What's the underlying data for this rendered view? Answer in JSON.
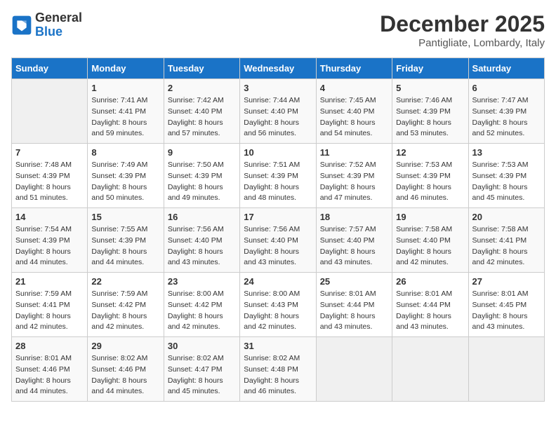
{
  "header": {
    "logo_line1": "General",
    "logo_line2": "Blue",
    "month": "December 2025",
    "location": "Pantigliate, Lombardy, Italy"
  },
  "days_of_week": [
    "Sunday",
    "Monday",
    "Tuesday",
    "Wednesday",
    "Thursday",
    "Friday",
    "Saturday"
  ],
  "weeks": [
    [
      {
        "day": "",
        "info": ""
      },
      {
        "day": "1",
        "info": "Sunrise: 7:41 AM\nSunset: 4:41 PM\nDaylight: 8 hours\nand 59 minutes."
      },
      {
        "day": "2",
        "info": "Sunrise: 7:42 AM\nSunset: 4:40 PM\nDaylight: 8 hours\nand 57 minutes."
      },
      {
        "day": "3",
        "info": "Sunrise: 7:44 AM\nSunset: 4:40 PM\nDaylight: 8 hours\nand 56 minutes."
      },
      {
        "day": "4",
        "info": "Sunrise: 7:45 AM\nSunset: 4:40 PM\nDaylight: 8 hours\nand 54 minutes."
      },
      {
        "day": "5",
        "info": "Sunrise: 7:46 AM\nSunset: 4:39 PM\nDaylight: 8 hours\nand 53 minutes."
      },
      {
        "day": "6",
        "info": "Sunrise: 7:47 AM\nSunset: 4:39 PM\nDaylight: 8 hours\nand 52 minutes."
      }
    ],
    [
      {
        "day": "7",
        "info": "Sunrise: 7:48 AM\nSunset: 4:39 PM\nDaylight: 8 hours\nand 51 minutes."
      },
      {
        "day": "8",
        "info": "Sunrise: 7:49 AM\nSunset: 4:39 PM\nDaylight: 8 hours\nand 50 minutes."
      },
      {
        "day": "9",
        "info": "Sunrise: 7:50 AM\nSunset: 4:39 PM\nDaylight: 8 hours\nand 49 minutes."
      },
      {
        "day": "10",
        "info": "Sunrise: 7:51 AM\nSunset: 4:39 PM\nDaylight: 8 hours\nand 48 minutes."
      },
      {
        "day": "11",
        "info": "Sunrise: 7:52 AM\nSunset: 4:39 PM\nDaylight: 8 hours\nand 47 minutes."
      },
      {
        "day": "12",
        "info": "Sunrise: 7:53 AM\nSunset: 4:39 PM\nDaylight: 8 hours\nand 46 minutes."
      },
      {
        "day": "13",
        "info": "Sunrise: 7:53 AM\nSunset: 4:39 PM\nDaylight: 8 hours\nand 45 minutes."
      }
    ],
    [
      {
        "day": "14",
        "info": "Sunrise: 7:54 AM\nSunset: 4:39 PM\nDaylight: 8 hours\nand 44 minutes."
      },
      {
        "day": "15",
        "info": "Sunrise: 7:55 AM\nSunset: 4:39 PM\nDaylight: 8 hours\nand 44 minutes."
      },
      {
        "day": "16",
        "info": "Sunrise: 7:56 AM\nSunset: 4:40 PM\nDaylight: 8 hours\nand 43 minutes."
      },
      {
        "day": "17",
        "info": "Sunrise: 7:56 AM\nSunset: 4:40 PM\nDaylight: 8 hours\nand 43 minutes."
      },
      {
        "day": "18",
        "info": "Sunrise: 7:57 AM\nSunset: 4:40 PM\nDaylight: 8 hours\nand 43 minutes."
      },
      {
        "day": "19",
        "info": "Sunrise: 7:58 AM\nSunset: 4:40 PM\nDaylight: 8 hours\nand 42 minutes."
      },
      {
        "day": "20",
        "info": "Sunrise: 7:58 AM\nSunset: 4:41 PM\nDaylight: 8 hours\nand 42 minutes."
      }
    ],
    [
      {
        "day": "21",
        "info": "Sunrise: 7:59 AM\nSunset: 4:41 PM\nDaylight: 8 hours\nand 42 minutes."
      },
      {
        "day": "22",
        "info": "Sunrise: 7:59 AM\nSunset: 4:42 PM\nDaylight: 8 hours\nand 42 minutes."
      },
      {
        "day": "23",
        "info": "Sunrise: 8:00 AM\nSunset: 4:42 PM\nDaylight: 8 hours\nand 42 minutes."
      },
      {
        "day": "24",
        "info": "Sunrise: 8:00 AM\nSunset: 4:43 PM\nDaylight: 8 hours\nand 42 minutes."
      },
      {
        "day": "25",
        "info": "Sunrise: 8:01 AM\nSunset: 4:44 PM\nDaylight: 8 hours\nand 43 minutes."
      },
      {
        "day": "26",
        "info": "Sunrise: 8:01 AM\nSunset: 4:44 PM\nDaylight: 8 hours\nand 43 minutes."
      },
      {
        "day": "27",
        "info": "Sunrise: 8:01 AM\nSunset: 4:45 PM\nDaylight: 8 hours\nand 43 minutes."
      }
    ],
    [
      {
        "day": "28",
        "info": "Sunrise: 8:01 AM\nSunset: 4:46 PM\nDaylight: 8 hours\nand 44 minutes."
      },
      {
        "day": "29",
        "info": "Sunrise: 8:02 AM\nSunset: 4:46 PM\nDaylight: 8 hours\nand 44 minutes."
      },
      {
        "day": "30",
        "info": "Sunrise: 8:02 AM\nSunset: 4:47 PM\nDaylight: 8 hours\nand 45 minutes."
      },
      {
        "day": "31",
        "info": "Sunrise: 8:02 AM\nSunset: 4:48 PM\nDaylight: 8 hours\nand 46 minutes."
      },
      {
        "day": "",
        "info": ""
      },
      {
        "day": "",
        "info": ""
      },
      {
        "day": "",
        "info": ""
      }
    ]
  ]
}
